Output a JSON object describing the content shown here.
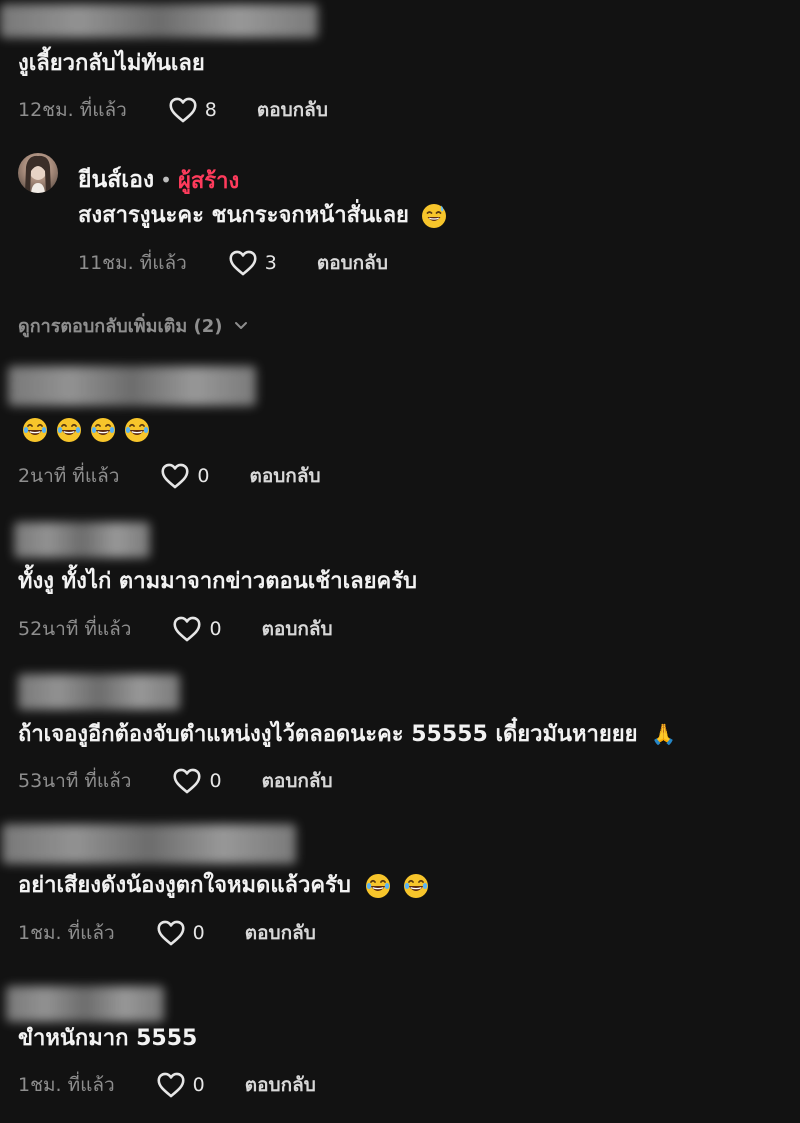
{
  "comments": [
    {
      "text": "งูเลี้ยวกลับไม่ทันเลย",
      "time": "12ชม. ที่แล้ว",
      "likes": "8",
      "reply": "ตอบกลับ"
    },
    {
      "author": "ยีนส์เอง",
      "dot": "•",
      "creator_badge": "ผู้สร้าง",
      "text": "สงสารงูนะคะ ชนกระจกหน้าสั่นเลย",
      "emoji": "😅",
      "time": "11ชม. ที่แล้ว",
      "likes": "3",
      "reply": "ตอบกลับ"
    },
    {
      "text": "",
      "emojis": [
        "😂",
        "😂",
        "😂",
        "😂"
      ],
      "time": "2นาที ที่แล้ว",
      "likes": "0",
      "reply": "ตอบกลับ"
    },
    {
      "text": "ทั้งงู ทั้งไก่ ตามมาจากข่าวตอนเช้าเลยครับ",
      "time": "52นาที ที่แล้ว",
      "likes": "0",
      "reply": "ตอบกลับ"
    },
    {
      "text": "ถ้าเจองูอีกต้องจับตำแหน่งงูไว้ตลอดนะคะ 55555 เดี๋ยวมันหายยย",
      "trailing_glyph": "🙏",
      "time": "53นาที ที่แล้ว",
      "likes": "0",
      "reply": "ตอบกลับ"
    },
    {
      "text": "อย่าเสียงดังน้องงูตกใจหมดแล้วครับ",
      "emojis": [
        "😂",
        "😂"
      ],
      "time": "1ชม. ที่แล้ว",
      "likes": "0",
      "reply": "ตอบกลับ"
    },
    {
      "text": "ขำหนักมาก 5555",
      "time": "1ชม. ที่แล้ว",
      "likes": "0",
      "reply": "ตอบกลับ"
    }
  ],
  "more_replies": "ดูการตอบกลับเพิ่มเติม (2)",
  "colors": {
    "background": "#121212",
    "creator": "#ff3b5c",
    "muted": "#8e8e8e"
  },
  "icons": {
    "like": "heart-outline-icon",
    "expand": "chevron-down-icon"
  }
}
